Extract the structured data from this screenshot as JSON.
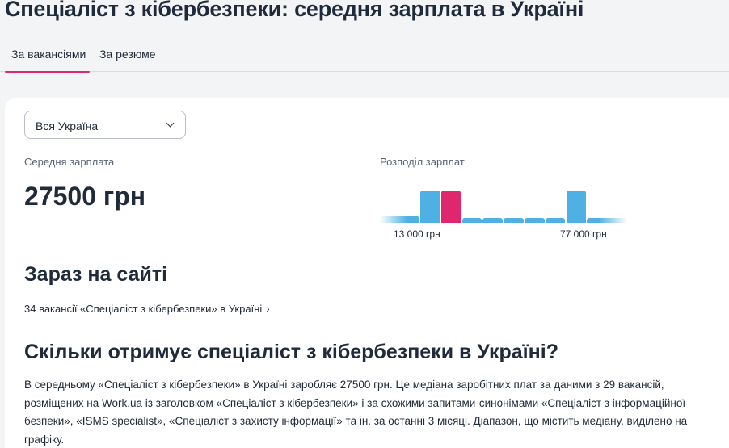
{
  "header": {
    "title": "Спеціаліст з кібербезпеки: середня зарплата в Україні"
  },
  "tabs": [
    {
      "label": "За вакансіями",
      "active": true
    },
    {
      "label": "За резюме",
      "active": false
    }
  ],
  "filter": {
    "region_selected": "Вся Україна"
  },
  "salary": {
    "avg_label": "Середня зарплата",
    "avg_value": "27500 грн"
  },
  "distribution": {
    "label": "Розподіл зарплат",
    "tick_left": "13 000 грн",
    "tick_right": "77 000 грн",
    "bars": [
      0.2,
      0.9,
      0.9,
      0.14,
      0.14,
      0.14,
      0.14,
      0.14,
      0.9,
      0.14
    ],
    "highlight_index": 2,
    "colors": {
      "bar": "#4fb0e3",
      "highlight": "#e0266d"
    }
  },
  "now_on_site": {
    "title": "Зараз на сайті",
    "link_text": "34 вакансії «Спеціаліст з кібербезпеки» в Україні",
    "link_chevron": "›"
  },
  "question": {
    "title": "Скільки отримує спеціаліст з кібербезпеки в Україні?",
    "paragraph": "В середньому «Спеціаліст з кібербезпеки» в Україні заробляє 27500 грн. Це медіана заробітних плат за даними з 29 вакансій, розміщених на Work.ua із заголовком «Спеціаліст з кібербезпеки» і за схожими запитами-синонімами «Спеціаліст з інформаційної безпеки», «ISMS specialist», «Спеціаліст з захисту інформації» та ін. за останні 3 місяці. Діапазон, що містить медіану, виділено на графіку."
  },
  "colors": {
    "accent": "#e0266d",
    "text": "#1f2a3a",
    "muted": "#5a6473"
  }
}
